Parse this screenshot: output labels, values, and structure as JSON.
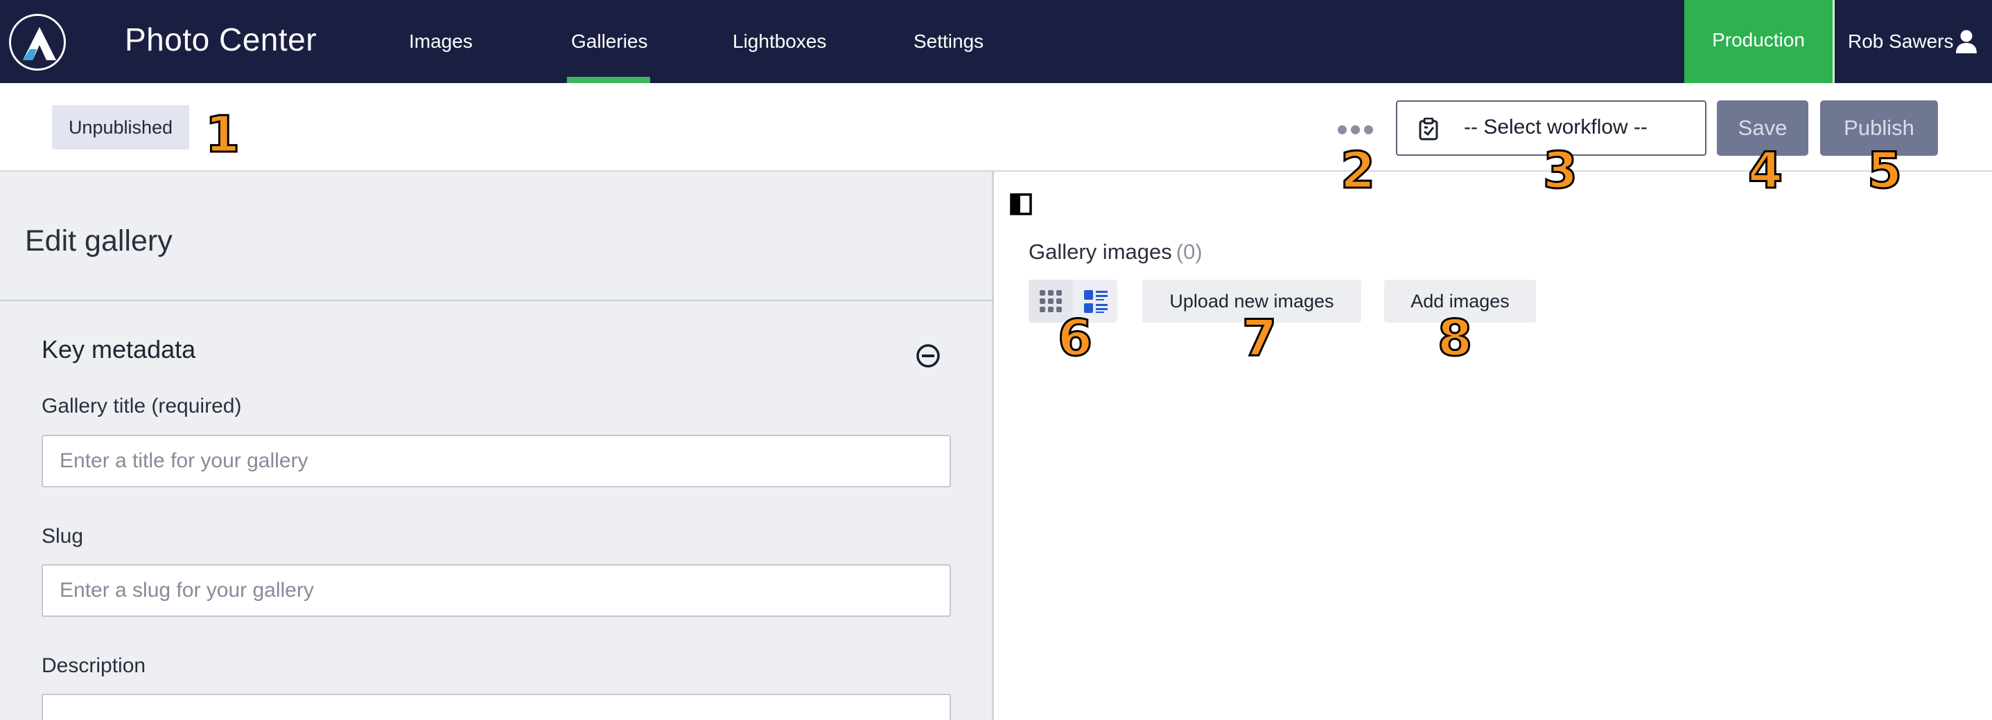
{
  "header": {
    "app_title": "Photo Center",
    "nav": [
      {
        "label": "Images",
        "active": false
      },
      {
        "label": "Galleries",
        "active": true
      },
      {
        "label": "Lightboxes",
        "active": false
      },
      {
        "label": "Settings",
        "active": false
      }
    ],
    "environment": "Production",
    "user_name": "Rob Sawers",
    "colors": {
      "bar": "#1a1f42",
      "accent": "#2eb14f"
    }
  },
  "toolbar": {
    "status": "Unpublished",
    "more_icon": "ellipsis-icon",
    "workflow_placeholder": "-- Select workflow --",
    "save_label": "Save",
    "publish_label": "Publish"
  },
  "editor": {
    "title": "Edit gallery",
    "section_title": "Key metadata",
    "fields": {
      "title_label": "Gallery title (required)",
      "title_placeholder": "Enter a title for your gallery",
      "slug_label": "Slug",
      "slug_placeholder": "Enter a slug for your gallery",
      "description_label": "Description"
    }
  },
  "gallery": {
    "heading": "Gallery images",
    "count": "(0)",
    "upload_label": "Upload new images",
    "add_label": "Add images"
  },
  "markers": [
    "1",
    "2",
    "3",
    "4",
    "5",
    "6",
    "7",
    "8"
  ]
}
